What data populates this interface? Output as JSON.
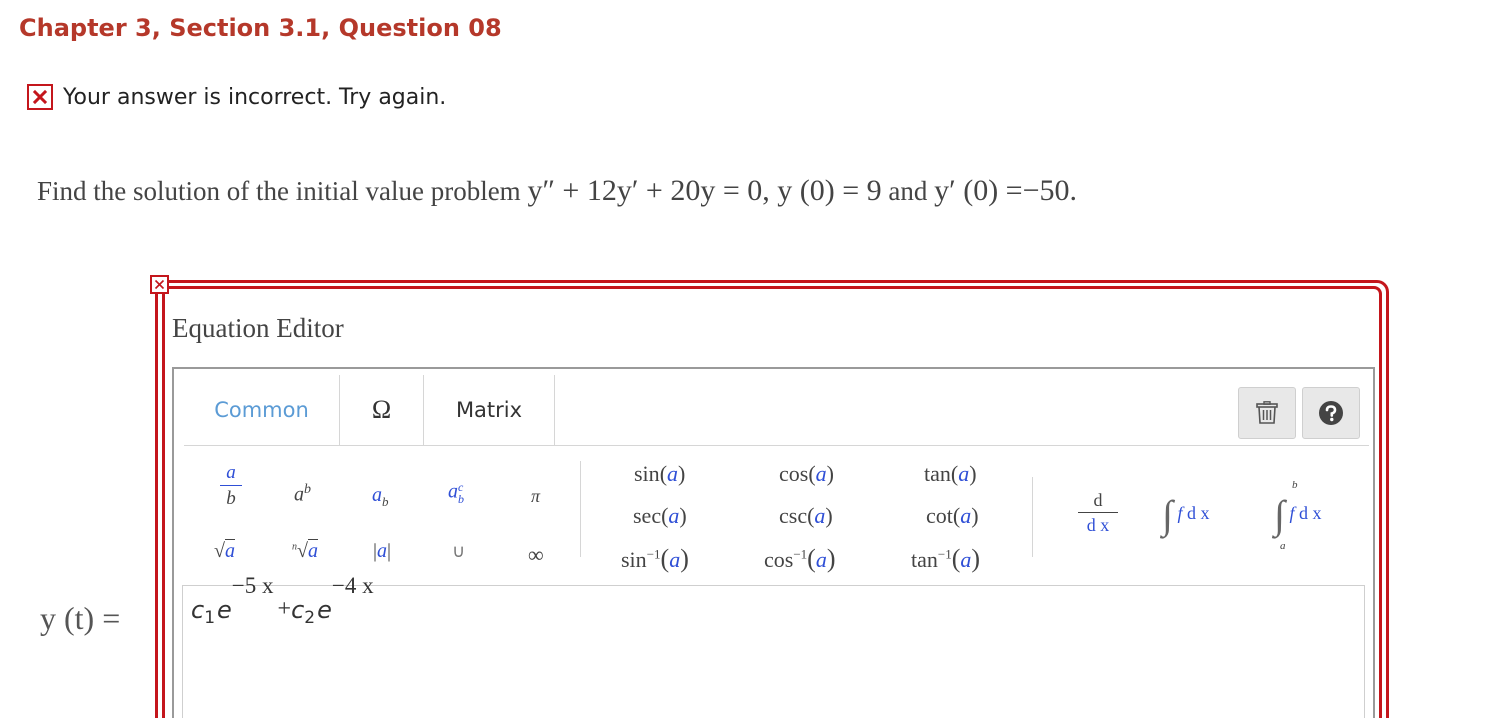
{
  "header": {
    "chapter_title": "Chapter 3, Section 3.1, Question 08"
  },
  "feedback": {
    "icon": "x-mark-icon",
    "text": "Your answer is incorrect.  Try again.",
    "color": "#c4161c"
  },
  "question": {
    "prefix": "Find the solution of the initial value problem",
    "equation": "y″ + 12y′ + 20y = 0, y (0) = 9",
    "connector": "and",
    "condition": "y′ (0) =−50."
  },
  "answer": {
    "label": "y (t) =",
    "expression": {
      "c1": "c",
      "c1_sub": "1",
      "e1": "e",
      "exp1": "−5 x",
      "plus": "+",
      "c2": "c",
      "c2_sub": "2",
      "e2": "e",
      "exp2": "−4 x"
    }
  },
  "editor": {
    "title": "Equation Editor",
    "tabs": [
      "Common",
      "Ω",
      "Matrix"
    ],
    "active_tab": "Common",
    "active_tab_color": "#5b9bd5",
    "tools": [
      "trash-icon",
      "help-icon"
    ],
    "palette": {
      "row1": [
        "a/b",
        "a^b",
        "a_b",
        "a_b^c",
        "π"
      ],
      "row2": [
        "√a",
        "ⁿ√a",
        "|a|",
        "∪",
        "∞"
      ],
      "trig": {
        "col1": [
          "sin(a)",
          "sec(a)",
          "sin⁻¹(a)"
        ],
        "col2": [
          "cos(a)",
          "csc(a)",
          "cos⁻¹(a)"
        ],
        "col3": [
          "tan(a)",
          "cot(a)",
          "tan⁻¹(a)"
        ]
      },
      "calculus": [
        "d/dx",
        "∫ f dx",
        "∫ₐᵇ f dx"
      ]
    },
    "frame_color": "#c4161c"
  },
  "glyphs": {
    "a": "a",
    "b": "b",
    "c": "c",
    "n": "n",
    "pi": "π",
    "union": "∪",
    "infinity": "∞",
    "sqrt": "√",
    "abs_bar": "|",
    "omega": "Ω",
    "d": "d",
    "dx": "d x",
    "f": "f",
    "integral": "∫",
    "sin": "sin",
    "cos": "cos",
    "tan": "tan",
    "sec": "sec",
    "csc": "csc",
    "cot": "cot",
    "inv": "−1",
    "lparen": "(",
    "rparen": ")"
  }
}
